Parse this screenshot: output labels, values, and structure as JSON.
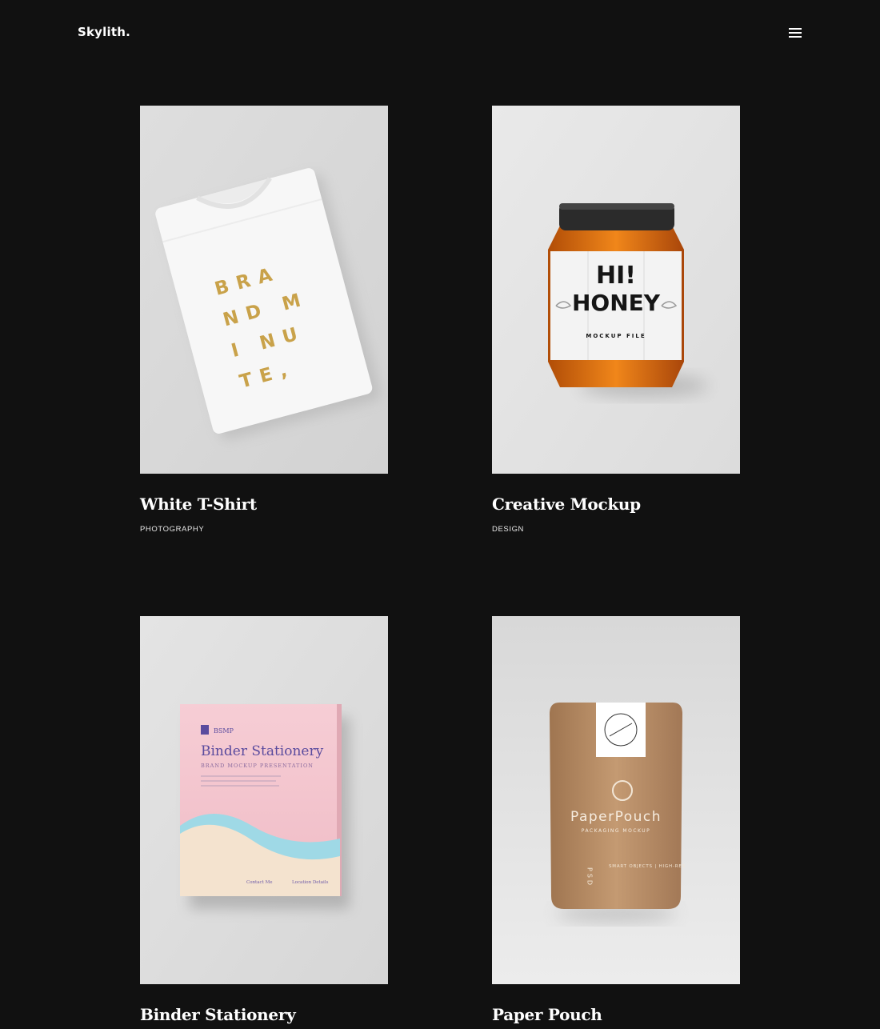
{
  "header": {
    "logo": "Skylith.",
    "menu_icon": "hamburger-menu-icon"
  },
  "portfolio": [
    {
      "title": "White T-Shirt",
      "category": "PHOTOGRAPHY",
      "image_text": [
        "BRA",
        "ND M",
        "I NU",
        "TE,"
      ]
    },
    {
      "title": "Creative Mockup",
      "category": "DESIGN",
      "image_text": [
        "HI!",
        "HONEY",
        "MOCKUP FILE"
      ]
    },
    {
      "title": "Binder Stationery",
      "category": "",
      "image_text": [
        "BSMP",
        "Binder Stationery",
        "BRAND MOCKUP PRESENTATION",
        "Contact Me",
        "Location Details"
      ]
    },
    {
      "title": "Paper Pouch",
      "category": "",
      "image_text": [
        "PaperPouch",
        "PACKAGING MOCKUP",
        "PSD",
        "SMART OBJECTS | HIGH-RES"
      ]
    }
  ],
  "colors": {
    "background": "#111111",
    "text": "#ffffff",
    "gold": "#c9a24a",
    "honey": "#e67a16",
    "kraft": "#b88e67",
    "pink": "#f3c6cf"
  }
}
